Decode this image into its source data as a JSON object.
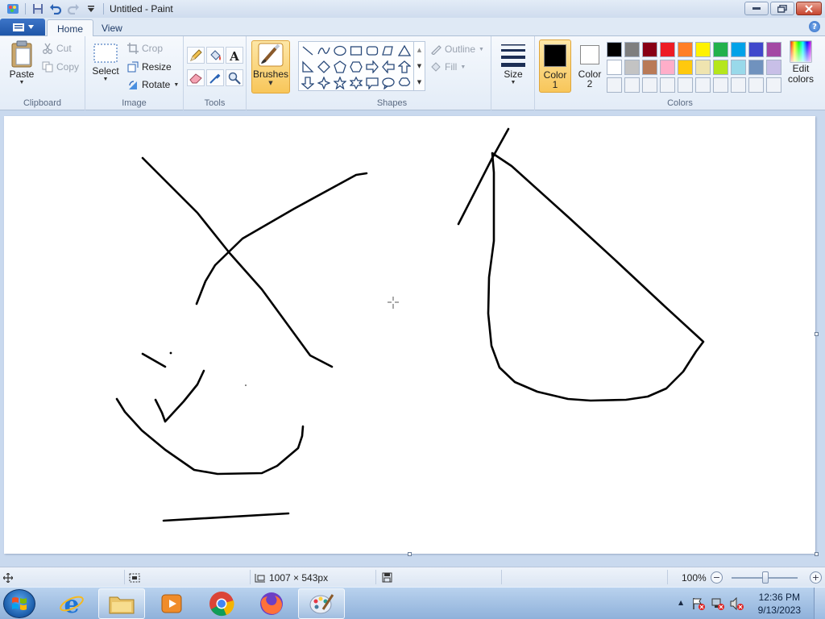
{
  "window": {
    "title": "Untitled - Paint"
  },
  "tabs": [
    {
      "label": "Home"
    },
    {
      "label": "View"
    }
  ],
  "clipboard": {
    "group_label": "Clipboard",
    "paste_label": "Paste",
    "cut_label": "Cut",
    "copy_label": "Copy"
  },
  "image": {
    "group_label": "Image",
    "select_label": "Select",
    "crop_label": "Crop",
    "resize_label": "Resize",
    "rotate_label": "Rotate"
  },
  "tools": {
    "group_label": "Tools"
  },
  "brushes": {
    "label": "Brushes"
  },
  "shapes": {
    "group_label": "Shapes",
    "outline_label": "Outline",
    "fill_label": "Fill"
  },
  "size": {
    "label": "Size"
  },
  "colors": {
    "group_label": "Colors",
    "color1_label": "Color",
    "color1_num": "1",
    "color2_label": "Color",
    "color2_num": "2",
    "edit_label": "Edit",
    "edit_label2": "colors",
    "color1_value": "#000000",
    "color2_value": "#ffffff",
    "palette_row1": [
      "#000000",
      "#7f7f7f",
      "#880015",
      "#ed1c24",
      "#ff7f27",
      "#fff200",
      "#22b14c",
      "#00a2e8",
      "#3f48cc",
      "#a349a4"
    ],
    "palette_row2": [
      "#ffffff",
      "#c3c3c3",
      "#b97a57",
      "#ffaec9",
      "#ffc90e",
      "#efe4b0",
      "#b5e61d",
      "#99d9ea",
      "#7092be",
      "#c8bfe7"
    ],
    "palette_row3": [
      "#f0f3f8",
      "#f0f3f8",
      "#f0f3f8",
      "#f0f3f8",
      "#f0f3f8",
      "#f0f3f8",
      "#f0f3f8",
      "#f0f3f8",
      "#f0f3f8",
      "#f0f3f8"
    ]
  },
  "status": {
    "dimensions": "1007 × 543px",
    "zoom": "100%",
    "zoom_level": 1.0
  },
  "taskbar": {
    "time": "12:36 PM",
    "date": "9/13/2023",
    "apps": [
      "internet-explorer-icon",
      "file-explorer-icon",
      "media-player-icon",
      "chrome-icon",
      "firefox-icon",
      "paint-icon"
    ]
  }
}
